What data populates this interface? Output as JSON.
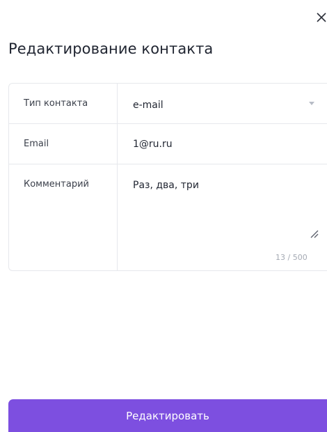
{
  "dialog": {
    "title": "Редактирование контакта",
    "close_icon": "close-icon"
  },
  "form": {
    "contact_type": {
      "label": "Тип контакта",
      "value": "e-mail",
      "caret_icon": "chevron-down-icon"
    },
    "email": {
      "label": "Email",
      "value": "1@ru.ru"
    },
    "comment": {
      "label": "Комментарий",
      "value": "Раз, два, три",
      "counter": "13 / 500",
      "resize_icon": "resize-handle-icon"
    }
  },
  "actions": {
    "submit_label": "Редактировать",
    "accent_color": "#7d4fe0"
  }
}
